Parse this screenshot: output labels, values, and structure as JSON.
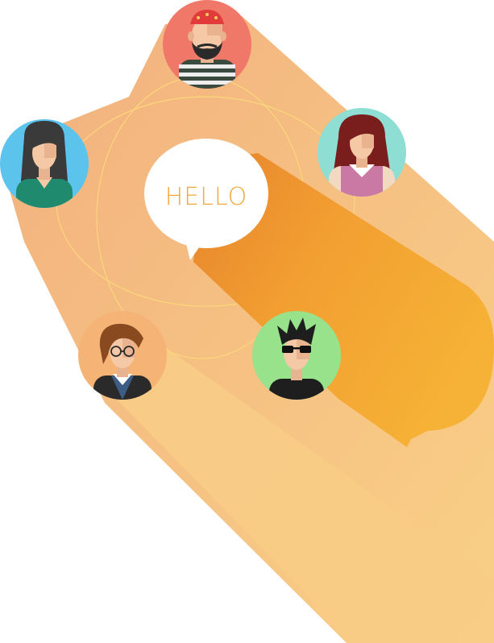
{
  "greeting": {
    "text": "HELLO"
  },
  "colors": {
    "shadow_light": "#F8CD85",
    "shadow_mid": "#F4B87F",
    "bubble_shadow": "#F3A22F",
    "bubble_shadow_dark": "#E8872E",
    "orbit_ring": "#FBD77A",
    "bubble_fill": "#FFFFFF",
    "hello_text": "#F3A93A"
  },
  "avatars": [
    {
      "name": "man-bandana-beard",
      "bg_color": "#F07868"
    },
    {
      "name": "woman-dark-hair-green-top",
      "bg_color": "#5BC3EC"
    },
    {
      "name": "woman-red-hair-pink-top",
      "bg_color": "#8EDED3"
    },
    {
      "name": "man-glasses-brown-hair",
      "bg_color": "#F6B376"
    },
    {
      "name": "man-sunglasses-spiky-hair",
      "bg_color": "#98E28B"
    }
  ]
}
